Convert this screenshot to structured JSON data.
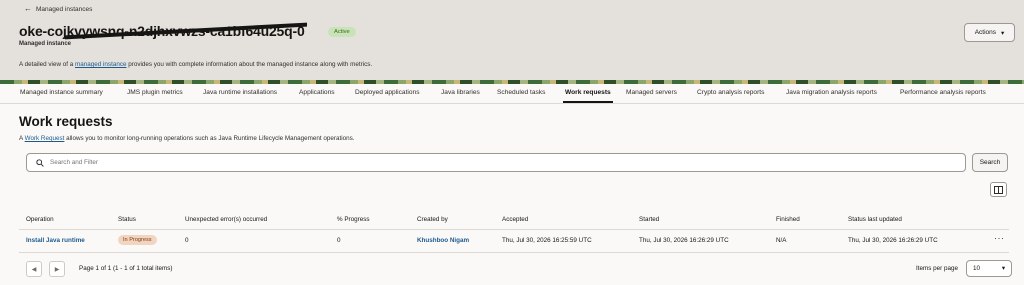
{
  "header": {
    "back_label": "Managed instances",
    "title_visible": "oke-coj",
    "title_redacted": "kvywsnq-n2djhxvwzs-ca1bf64u25q-0",
    "status_badge": "Active",
    "subtitle": "Managed instance",
    "desc_prefix": "A detailed view of a ",
    "desc_link": "managed instance",
    "desc_suffix": " provides you with complete information about the managed instance along with metrics.",
    "actions_label": "Actions"
  },
  "tabs": [
    {
      "label": "Managed instance summary"
    },
    {
      "label": "JMS plugin metrics"
    },
    {
      "label": "Java runtime installations"
    },
    {
      "label": "Applications"
    },
    {
      "label": "Deployed applications"
    },
    {
      "label": "Java libraries"
    },
    {
      "label": "Scheduled tasks"
    },
    {
      "label": "Work requests"
    },
    {
      "label": "Managed servers"
    },
    {
      "label": "Crypto analysis reports"
    },
    {
      "label": "Java migration analysis reports"
    },
    {
      "label": "Performance analysis reports"
    }
  ],
  "work_requests": {
    "title": "Work requests",
    "desc_prefix": "A ",
    "desc_link": "Work Request",
    "desc_suffix": " allows you to monitor long-running operations such as Java Runtime Lifecycle Management operations.",
    "search_placeholder": "Search and Filter",
    "search_button": "Search",
    "columns": [
      "Operation",
      "Status",
      "Unexpected error(s) occurred",
      "% Progress",
      "Created by",
      "Accepted",
      "Started",
      "Finished",
      "Status last updated"
    ],
    "rows": [
      {
        "operation": "Install Java runtime",
        "status": "In Progress",
        "errors": "0",
        "progress": "0",
        "created_by": "Khushboo Nigam",
        "accepted": "Thu, Jul 30, 2026 16:25:59 UTC",
        "started": "Thu, Jul 30, 2026 16:26:29 UTC",
        "finished": "N/A",
        "status_last_updated": "Thu, Jul 30, 2026 16:26:29 UTC"
      }
    ],
    "more_actions": "···"
  },
  "pagination": {
    "summary": "Page 1 of 1 (1 - 1 of 1 total items)",
    "items_per_page_label": "Items per page",
    "items_per_page_value": "10"
  },
  "colors": {
    "active_badge_bg": "#c7e3b7",
    "in_progress_badge_bg": "#f2d5c0",
    "link": "#1d5a8e",
    "header_bg": "#e4e1dd"
  }
}
